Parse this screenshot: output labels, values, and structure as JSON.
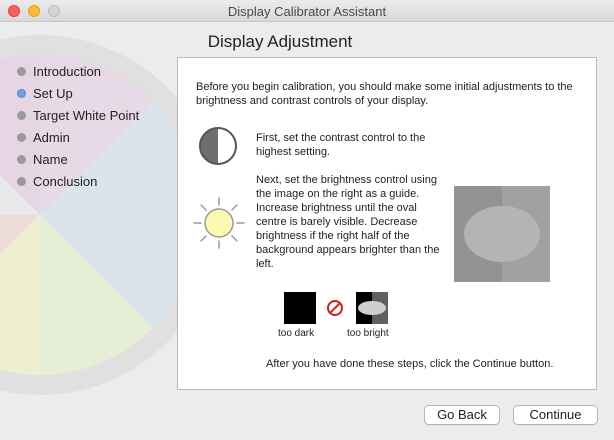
{
  "window": {
    "title": "Display Calibrator Assistant"
  },
  "sidebar": {
    "steps": [
      {
        "label": "Introduction",
        "active": false
      },
      {
        "label": "Set Up",
        "active": true
      },
      {
        "label": "Target White Point",
        "active": false
      },
      {
        "label": "Admin",
        "active": false
      },
      {
        "label": "Name",
        "active": false
      },
      {
        "label": "Conclusion",
        "active": false
      }
    ]
  },
  "main": {
    "heading": "Display Adjustment",
    "intro": "Before you begin calibration, you should make some initial adjustments to the brightness and contrast controls of your display.",
    "contrast_text": "First, set the contrast control to the highest setting.",
    "brightness_text": "Next, set the brightness control using the image on the right as a guide. Increase brightness until the oval centre is barely visible. Decrease brightness if the right half of the background appears brighter than the left.",
    "example_dark_label": "too dark",
    "example_bright_label": "too bright",
    "footer": "After you have done these steps, click the Continue button."
  },
  "buttons": {
    "back": "Go Back",
    "continue": "Continue"
  },
  "colors": {
    "active_step": "#6fa3e4",
    "inactive_step": "#9a9a9a",
    "no_symbol": "#d21f1f"
  },
  "icons": [
    "contrast-icon",
    "brightness-sun-icon",
    "prohibited-icon"
  ]
}
